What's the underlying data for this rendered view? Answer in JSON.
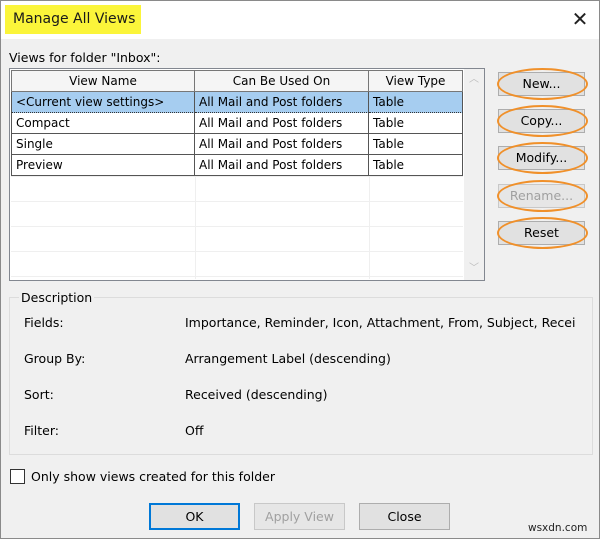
{
  "window": {
    "title": "Manage All Views",
    "close_glyph": "✕"
  },
  "folder_label": "Views for folder \"Inbox\":",
  "views_table": {
    "columns": [
      "View Name",
      "Can Be Used On",
      "View Type"
    ],
    "rows": [
      {
        "name": "<Current view settings>",
        "used_on": "All Mail and Post folders",
        "type": "Table",
        "selected": true
      },
      {
        "name": "Compact",
        "used_on": "All Mail and Post folders",
        "type": "Table",
        "selected": false
      },
      {
        "name": "Single",
        "used_on": "All Mail and Post folders",
        "type": "Table",
        "selected": false
      },
      {
        "name": "Preview",
        "used_on": "All Mail and Post folders",
        "type": "Table",
        "selected": false
      }
    ],
    "scroll_up_glyph": "︿",
    "scroll_down_glyph": "﹀"
  },
  "side_buttons": {
    "new": "New...",
    "copy": "Copy...",
    "modify": "Modify...",
    "rename": "Rename...",
    "reset": "Reset"
  },
  "description": {
    "legend": "Description",
    "fields_label": "Fields:",
    "fields_value": "Importance, Reminder, Icon, Attachment, From, Subject, Recei",
    "group_by_label": "Group By:",
    "group_by_value": "Arrangement Label (descending)",
    "sort_label": "Sort:",
    "sort_value": "Received (descending)",
    "filter_label": "Filter:",
    "filter_value": "Off"
  },
  "only_this_folder": {
    "label": "Only show views created for this folder",
    "checked": false
  },
  "bottom_buttons": {
    "ok": "OK",
    "apply_view": "Apply View",
    "close": "Close"
  },
  "watermark": "wsxdn.com",
  "colors": {
    "title_highlight": "#fbf53a",
    "selection": "#a6cdf0",
    "annotation_ring": "#f0902a",
    "default_button_border": "#0078d7"
  }
}
